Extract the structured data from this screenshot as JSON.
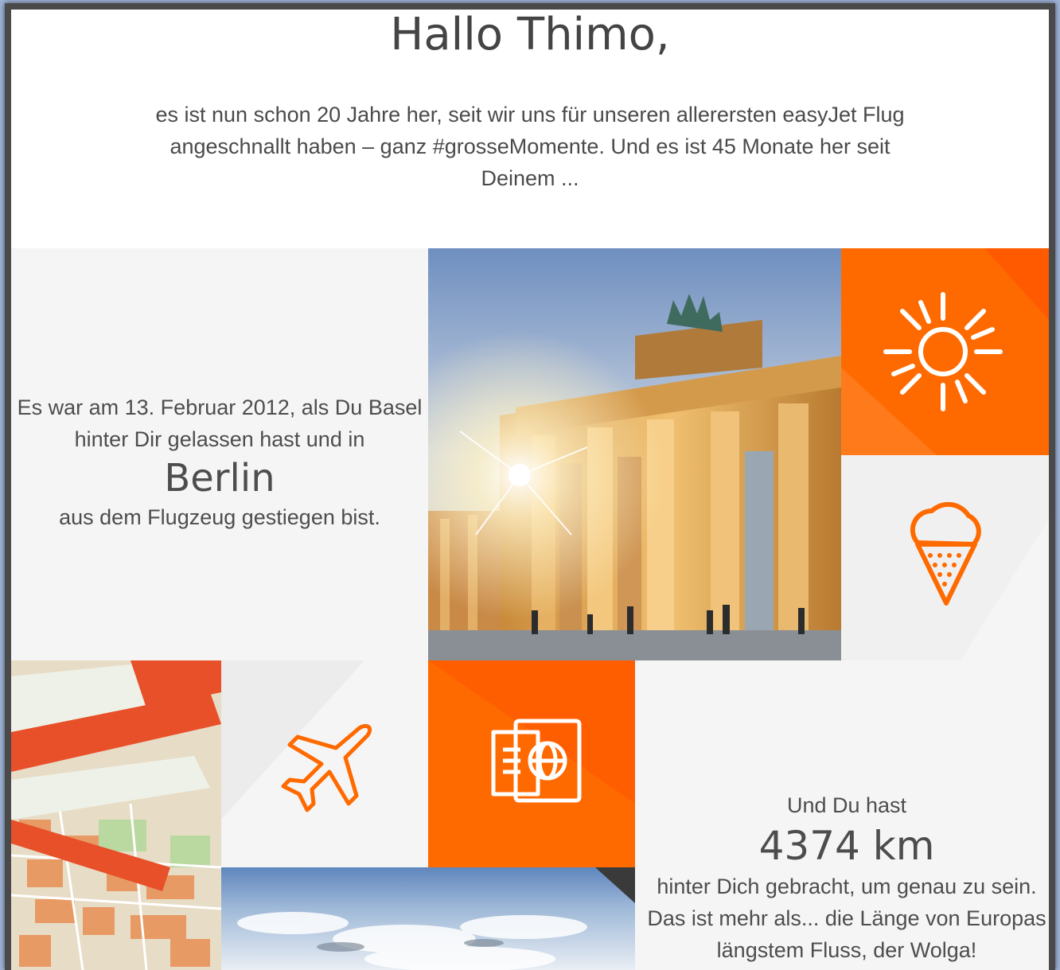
{
  "email": {
    "greeting": "Hallo Thimo,",
    "intro": "es ist nun schon 20 Jahre her, seit wir uns für unseren allerersten easyJet Flug angeschnallt haben – ganz #grosseMomente. Und es ist 45 Monate her seit Deinem ...",
    "story": {
      "line_before": "Es war am 13. Februar 2012, als Du Basel hinter Dir gelassen hast und in",
      "city": "Berlin",
      "line_after": "aus dem Flugzeug gestiegen bist."
    },
    "distance": {
      "line_before": "Und Du hast",
      "value": "4374 km",
      "line_after": "hinter Dich gebracht, um genau zu sein. Das ist mehr als... die Länge von Europas längstem Fluss, der Wolga!"
    }
  },
  "icons": [
    "sun-icon",
    "ice-cream-icon",
    "airplane-icon",
    "passport-icon"
  ],
  "colors": {
    "accent": "#ff6a00",
    "tile_gray": "#f5f5f5",
    "text": "#4d4d4d"
  }
}
